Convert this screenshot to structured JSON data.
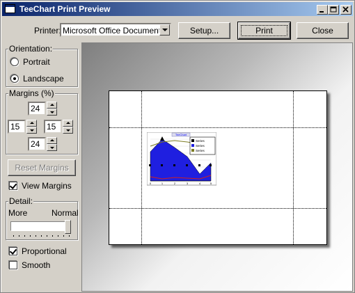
{
  "window": {
    "title": "TeeChart Print Preview"
  },
  "title_buttons": [
    "minimize-button",
    "maximize-button",
    "close-window-button"
  ],
  "printer": {
    "label": "Printer:",
    "value": "Microsoft Office Document Im"
  },
  "buttons": {
    "setup": "Setup...",
    "print": "Print",
    "close": "Close",
    "reset_margins": "Reset Margins"
  },
  "orientation": {
    "label": "Orientation:",
    "portrait": "Portrait",
    "landscape": "Landscape",
    "selected": "Landscape"
  },
  "margins": {
    "label": "Margins (%)",
    "top": "24",
    "left": "15",
    "right": "15",
    "bottom": "24"
  },
  "view_margins": {
    "label": "View Margins",
    "checked": true
  },
  "detail": {
    "label": "Detail:",
    "more": "More",
    "normal": "Normal",
    "level": 1.0
  },
  "proportional": {
    "label": "Proportional",
    "checked": true
  },
  "smooth": {
    "label": "Smooth",
    "checked": false
  },
  "mini_chart": {
    "title": "TeeChart",
    "legend": [
      "Series",
      "Series",
      "Series"
    ],
    "x_ticks": [
      "0",
      "1",
      "2",
      "3",
      "4",
      "5"
    ]
  },
  "colors": {
    "chart_blue": "#1f1fe0",
    "title_bar_start": "#0a246a",
    "title_bar_end": "#a6caf0"
  }
}
